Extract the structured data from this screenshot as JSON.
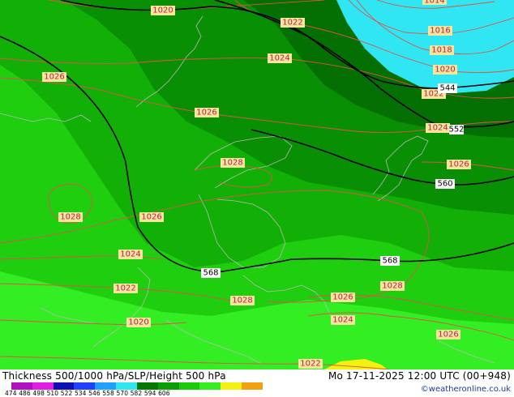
{
  "map": {
    "pressure_labels": [
      "1020",
      "1022",
      "1024",
      "1026",
      "1028",
      "1016",
      "1018",
      "1014"
    ],
    "thickness_labels": [
      "544",
      "552",
      "560",
      "568"
    ],
    "colors": {
      "green_lightest": "#33ee22",
      "green_light": "#1fcf0f",
      "green_mid": "#12b006",
      "green_dark": "#098f04",
      "green_darkest": "#047003",
      "cyan": "#2fe6f2",
      "yellow": "#f4f010",
      "slp_contour": "#e0524a",
      "thickness_contour": "#000000",
      "border": "#b8b8b8"
    }
  },
  "footer": {
    "title": "Thickness 500/1000 hPa/SLP/Height 500 hPa",
    "datetime": "Mo 17-11-2025 12:00 UTC (00+948)",
    "credit": "©weatheronline.co.uk",
    "legend_values": [
      "474",
      "486",
      "498",
      "510",
      "522",
      "534",
      "546",
      "558",
      "570",
      "582",
      "594",
      "606"
    ],
    "legend_colors": [
      "#b010c0",
      "#e020e0",
      "#1010b0",
      "#2040ff",
      "#20a0ff",
      "#30e6f0",
      "#067803",
      "#0c9e05",
      "#1cca0c",
      "#34ee22",
      "#f4f010",
      "#f0a010"
    ]
  }
}
